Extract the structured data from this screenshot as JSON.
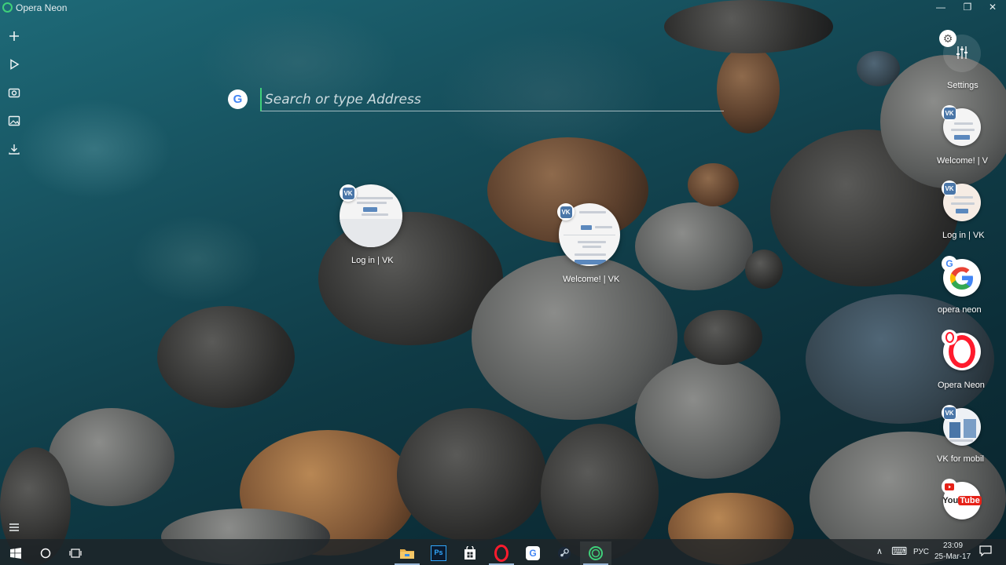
{
  "window": {
    "app_title": "Opera Neon",
    "minimize": "—",
    "maximize": "❐",
    "close": "✕"
  },
  "sidebar": {
    "items": [
      {
        "name": "new-tab",
        "glyph": "+"
      },
      {
        "name": "media-player",
        "glyph": "▷"
      },
      {
        "name": "snapshot",
        "glyph": "◘"
      },
      {
        "name": "gallery",
        "glyph": "▣"
      },
      {
        "name": "downloads",
        "glyph": "⤓"
      }
    ],
    "menu_glyph": "≡"
  },
  "search": {
    "engine_glyph": "G",
    "placeholder": "Search or type Address"
  },
  "center_tabs": [
    {
      "label": "Log in | VK"
    },
    {
      "label": "Welcome! | VK"
    }
  ],
  "right_panel": {
    "settings": {
      "label": "Settings",
      "gear_glyph": "⚙",
      "sliders_glyph": "⫶"
    },
    "speed_dials": [
      {
        "label": "Welcome! | V",
        "favicon": "VK"
      },
      {
        "label": "Log in | VK",
        "favicon": "VK"
      },
      {
        "label": "opera neon",
        "favicon": "G"
      },
      {
        "label": "Opera Neon",
        "favicon": "O"
      },
      {
        "label": "VK for mobil",
        "favicon": "VK"
      },
      {
        "label": "",
        "favicon": "YouTube"
      }
    ]
  },
  "taskbar": {
    "start_glyph": "⊞",
    "cortana_glyph": "○",
    "taskview_glyph": "⧉",
    "apps": [
      {
        "name": "file-explorer",
        "glyph": "▬",
        "color": "#e8b04a"
      },
      {
        "name": "photoshop",
        "glyph": "Ps",
        "color": "#31a8ff"
      },
      {
        "name": "store",
        "glyph": "⊞",
        "color": "#ffffff"
      },
      {
        "name": "opera",
        "glyph": "O",
        "color": "#ff1b2d"
      },
      {
        "name": "chrome",
        "glyph": "G",
        "color": "#4285f4"
      },
      {
        "name": "steam",
        "glyph": "♨",
        "color": "#c7d5e0"
      },
      {
        "name": "opera-neon",
        "glyph": "◎",
        "color": "#3fd07a"
      }
    ],
    "tray": {
      "chevron": "∧",
      "keyboard": "⌨",
      "language": "РУС",
      "time": "23:09",
      "date": "25-Mar-17",
      "notification_glyph": "▭"
    }
  }
}
